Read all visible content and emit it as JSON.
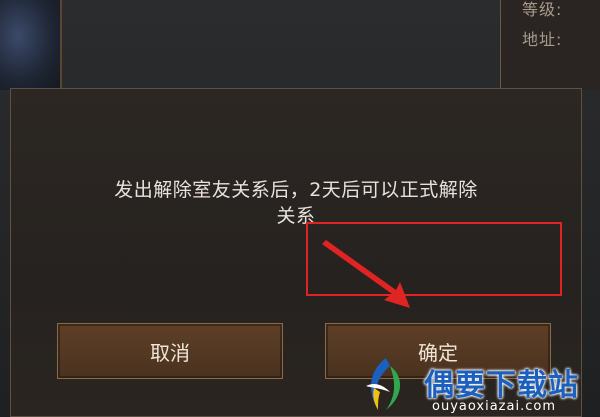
{
  "background": {
    "info_line_1": "等级:",
    "info_line_2": "地址:"
  },
  "dialog": {
    "message_line_1": "发出解除室友关系后，2天后可以正式解除",
    "message_line_2": "关系",
    "cancel_label": "取消",
    "confirm_label": "确定"
  },
  "annotation": {
    "highlight_color": "#e02424",
    "arrow_color": "#e02424"
  },
  "watermark": {
    "title": "偶要下载站",
    "url": "ouyaoxiazai.com"
  },
  "colors": {
    "button_bg": "#5e3f25",
    "button_border": "#8a6a48",
    "dialog_bg": "#2a2521",
    "text": "#e8e2da",
    "watermark_blue": "#1b5fbf"
  }
}
